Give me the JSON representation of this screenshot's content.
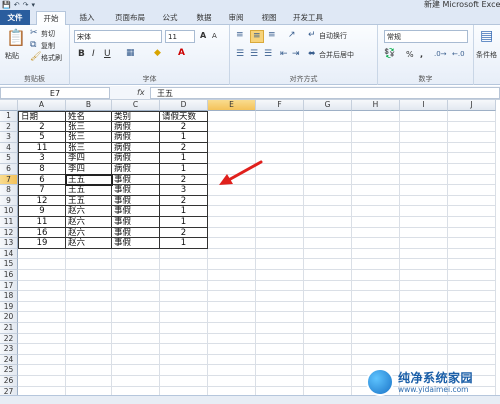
{
  "window": {
    "title": "新建 Microsoft Excel",
    "qat": [
      "💾",
      "↶",
      "↷",
      "▾"
    ]
  },
  "ribbon_tabs": [
    "文件",
    "开始",
    "插入",
    "页面布局",
    "公式",
    "数据",
    "审阅",
    "视图",
    "开发工具"
  ],
  "clipboard": {
    "paste": "粘贴",
    "cut": "剪切",
    "copy": "复制",
    "format_painter": "格式刷",
    "label": "剪贴板"
  },
  "font_group": {
    "font_name": "宋体",
    "font_size": "11",
    "bold": "B",
    "italic": "I",
    "underline": "U",
    "grow": "A",
    "shrink": "A",
    "label": "字体"
  },
  "align_group": {
    "wrap_text": "自动换行",
    "merge_center": "合并后居中",
    "label": "对齐方式"
  },
  "number_group": {
    "format": "常规",
    "percent": "%",
    "comma": ",",
    "label": "数字"
  },
  "styles_group": {
    "conditional": "条件格"
  },
  "formula_bar": {
    "name_box": "E7",
    "fx": "fx",
    "value": "王五"
  },
  "columns": [
    "A",
    "B",
    "C",
    "D",
    "E",
    "F",
    "G",
    "H",
    "I",
    "J"
  ],
  "rows": [
    "1",
    "2",
    "3",
    "4",
    "5",
    "6",
    "7",
    "8",
    "9",
    "10",
    "11",
    "12",
    "13",
    "14",
    "15",
    "16",
    "17",
    "18",
    "19",
    "20",
    "21",
    "22",
    "23",
    "24",
    "25",
    "26",
    "27"
  ],
  "table": {
    "headers": [
      "日期",
      "姓名",
      "类别",
      "请假天数"
    ],
    "rows": [
      [
        "2",
        "张三",
        "病假",
        "2"
      ],
      [
        "5",
        "张三",
        "病假",
        "1"
      ],
      [
        "11",
        "张三",
        "病假",
        "2"
      ],
      [
        "3",
        "李四",
        "病假",
        "1"
      ],
      [
        "8",
        "李四",
        "病假",
        "1"
      ],
      [
        "6",
        "王五",
        "事假",
        "2"
      ],
      [
        "7",
        "王五",
        "事假",
        "3"
      ],
      [
        "12",
        "王五",
        "事假",
        "2"
      ],
      [
        "9",
        "赵六",
        "事假",
        "1"
      ],
      [
        "11",
        "赵六",
        "事假",
        "1"
      ],
      [
        "16",
        "赵六",
        "事假",
        "2"
      ],
      [
        "19",
        "赵六",
        "事假",
        "1"
      ]
    ]
  },
  "annotation": {
    "arrow_color": "#e0201c"
  },
  "watermark": {
    "brand": "纯净系统家园",
    "url": "www.yidaimei.com"
  }
}
